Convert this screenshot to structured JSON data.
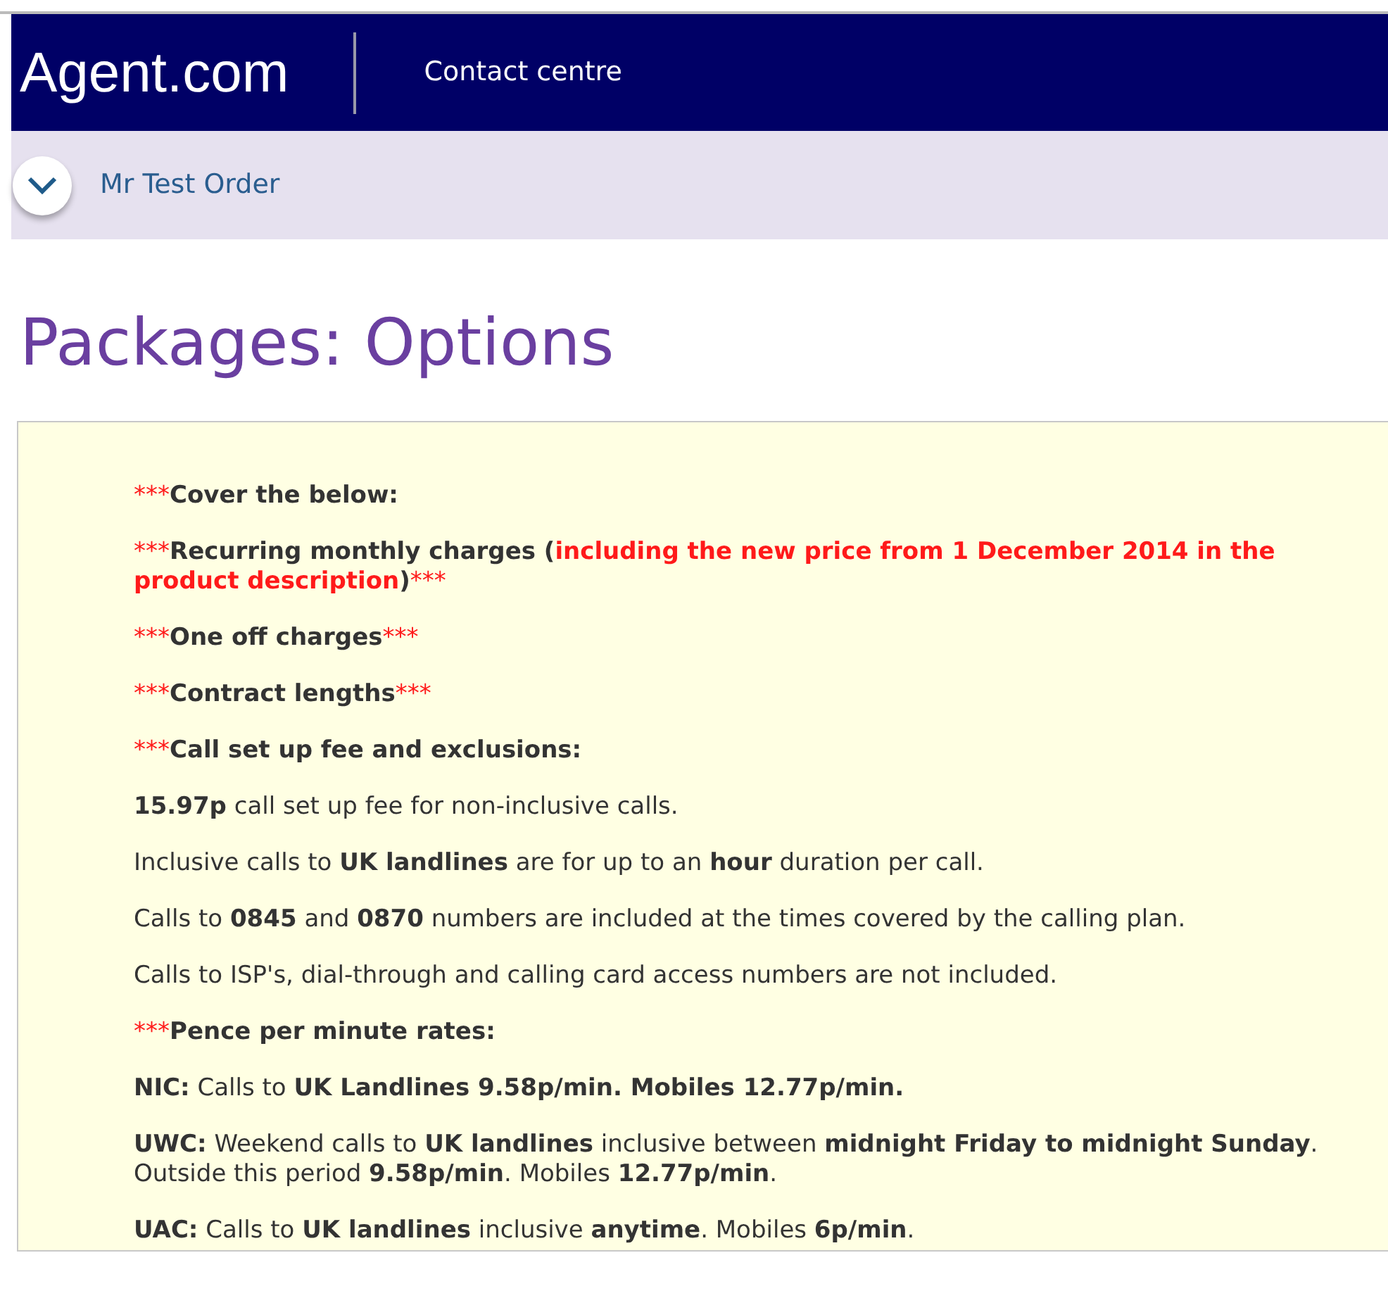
{
  "header": {
    "logo": "Agent.com",
    "section": "Contact centre"
  },
  "customer_bar": {
    "expanded": false,
    "name": "Mr Test Order"
  },
  "page_title": "Packages: Options",
  "notes": [
    {
      "kind": "heading",
      "segments": [
        {
          "text": "***",
          "red": true
        },
        {
          "text": "Cover the below:",
          "red": false
        }
      ]
    },
    {
      "kind": "heading",
      "segments": [
        {
          "text": "***",
          "red": true
        },
        {
          "text": "Recurring monthly charges (",
          "red": false
        },
        {
          "text": "including the new price from 1 December 2014 in the product description",
          "red": true
        },
        {
          "text": ")",
          "red": false
        },
        {
          "text": "***",
          "red": true
        }
      ]
    },
    {
      "kind": "heading",
      "segments": [
        {
          "text": "***",
          "red": true
        },
        {
          "text": "One off charges",
          "red": false
        },
        {
          "text": "***",
          "red": true
        }
      ]
    },
    {
      "kind": "heading",
      "segments": [
        {
          "text": "***",
          "red": true
        },
        {
          "text": "Contract lengths",
          "red": false
        },
        {
          "text": "***",
          "red": true
        }
      ]
    },
    {
      "kind": "heading",
      "segments": [
        {
          "text": "***",
          "red": true
        },
        {
          "text": "Call set up fee and exclusions:",
          "red": false
        }
      ]
    },
    {
      "kind": "body",
      "segments": [
        {
          "text": "**15.97p** call set up fee for non-inclusive calls.",
          "red": false
        }
      ]
    },
    {
      "kind": "body",
      "segments": [
        {
          "text": "Inclusive calls to **UK landlines** are for up to an **hour** duration per call.",
          "red": false
        }
      ]
    },
    {
      "kind": "body",
      "segments": [
        {
          "text": "Calls to **0845** and **0870** numbers are included at the times covered by the calling plan.",
          "red": false
        }
      ]
    },
    {
      "kind": "body",
      "segments": [
        {
          "text": "Calls to ISP's, dial-through and calling card access numbers are not included.",
          "red": false
        }
      ]
    },
    {
      "kind": "heading",
      "segments": [
        {
          "text": "***",
          "red": true
        },
        {
          "text": "Pence per minute rates:",
          "red": false
        }
      ]
    },
    {
      "kind": "body",
      "segments": [
        {
          "text": "**NIC:** Calls to **UK Landlines 9.58p/min. Mobiles 12.77p/min.**",
          "red": false
        }
      ]
    },
    {
      "kind": "body",
      "segments": [
        {
          "text": "**UWC:** Weekend calls to **UK landlines** inclusive between **midnight Friday to midnight Sunday**. Outside this period **9.58p/min**. Mobiles **12.77p/min**.",
          "red": false
        }
      ]
    },
    {
      "kind": "body",
      "segments": [
        {
          "text": "**UAC:** Calls to **UK landlines** inclusive **anytime**. Mobiles **6p/min**.",
          "red": false
        }
      ]
    }
  ]
}
